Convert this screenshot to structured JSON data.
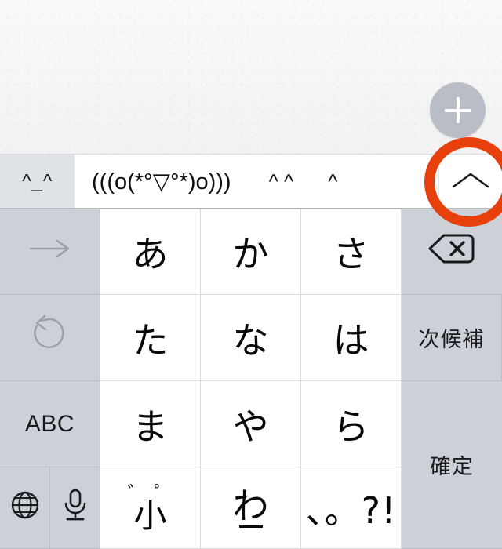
{
  "app": {
    "background_color": "#f4f4f5"
  },
  "fab": {
    "icon": "plus-icon",
    "label": "",
    "color": "#b9bec6"
  },
  "suggestion_bar": {
    "current_text": "^_^",
    "suggestions": [
      "(((o(*°▽°*)o)))",
      "^ ^",
      "^"
    ],
    "expand_icon": "chevron-up-icon"
  },
  "annotation": {
    "shape": "circle",
    "color": "#e8400c",
    "target": "expand-suggestions-button"
  },
  "keyboard": {
    "type": "japanese-kana-12key",
    "key_background": "#ffffff",
    "function_key_background": "#ccd0d7",
    "rows": [
      {
        "left": {
          "icon": "arrow-right-icon",
          "label": "",
          "dim": true
        },
        "chars": [
          "あ",
          "か",
          "さ"
        ],
        "right": {
          "icon": "backspace-icon",
          "label": ""
        }
      },
      {
        "left": {
          "icon": "undo-icon",
          "label": "",
          "dim": true
        },
        "chars": [
          "た",
          "な",
          "は"
        ],
        "right": {
          "icon": "",
          "label": "次候補"
        }
      },
      {
        "left": {
          "icon": "",
          "label": "ABC"
        },
        "chars": [
          "ま",
          "や",
          "ら"
        ],
        "right": {
          "icon": "",
          "label": "確定"
        }
      },
      {
        "left_a": {
          "icon": "globe-icon",
          "label": ""
        },
        "left_b": {
          "icon": "microphone-icon",
          "label": ""
        },
        "chars": [
          "小",
          "わ",
          "、。?!"
        ],
        "small_kana_marks": "゛゜"
      }
    ],
    "confirm_label": "確定",
    "next_candidate_label": "次候補",
    "abc_label": "ABC"
  }
}
